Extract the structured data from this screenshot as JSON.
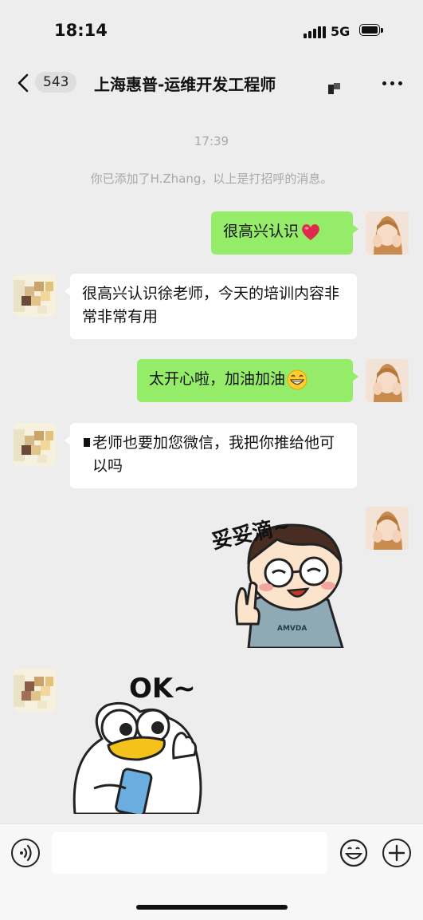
{
  "status_bar": {
    "time": "18:14",
    "network": "5G"
  },
  "header": {
    "back_count": "543",
    "title": "上海惠普-运维开发工程师"
  },
  "chat": {
    "timestamp": "17:39",
    "system_message": "你已添加了H.Zhang，以上是打招呼的消息。",
    "messages": [
      {
        "sender": "me",
        "text": "很高兴认识",
        "emoji": "red-heart"
      },
      {
        "sender": "other",
        "text": "很高兴认识徐老师，今天的培训内容非常非常有用"
      },
      {
        "sender": "me",
        "text": "太开心啦，加油加油",
        "emoji": "grinning-face"
      },
      {
        "sender": "other",
        "text": "老师也要加您微信，我把你推给他可以吗"
      },
      {
        "sender": "me",
        "type": "sticker",
        "sticker_text": "妥妥滴~",
        "shirt_text": "AMVDA"
      },
      {
        "sender": "other",
        "type": "sticker",
        "sticker_text": "OK~"
      }
    ]
  },
  "input_bar": {
    "placeholder": ""
  },
  "colors": {
    "my_bubble": "#95ec69",
    "other_bubble": "#ffffff",
    "background": "#ededed"
  }
}
